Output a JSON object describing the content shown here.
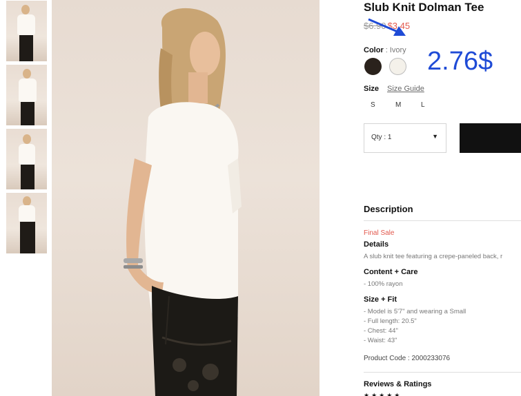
{
  "product": {
    "title": "Slub Knit Dolman Tee",
    "old_price": "$6.90",
    "sale_price": "$3.45"
  },
  "annotation": {
    "price_text": "2.76$",
    "arrow_color": "#1f4bd6"
  },
  "color": {
    "label": "Color",
    "separator": ":",
    "selected": "Ivory",
    "swatches": [
      "#2a221c",
      "#f4f1ea"
    ]
  },
  "size": {
    "label": "Size",
    "guide_label": "Size Guide",
    "options": [
      "S",
      "M",
      "L"
    ]
  },
  "quantity": {
    "label": "Qty : 1"
  },
  "description": {
    "title": "Description",
    "final_sale": "Final Sale",
    "details_title": "Details",
    "details_text": "A slub knit tee featuring a crepe-paneled back, r",
    "content_title": "Content + Care",
    "content_text": "- 100% rayon",
    "fit_title": "Size + Fit",
    "fit_lines": [
      "- Model is 5'7\" and wearing a Small",
      "- Full length: 20.5\"",
      "- Chest: 44\"",
      "- Waist: 43\""
    ],
    "product_code": "Product Code : 2000233076"
  },
  "reviews": {
    "title": "Reviews & Ratings"
  },
  "icons": {
    "caret": "chevron-down-icon",
    "arrow": "arrow-icon",
    "stars": "star-icon"
  }
}
